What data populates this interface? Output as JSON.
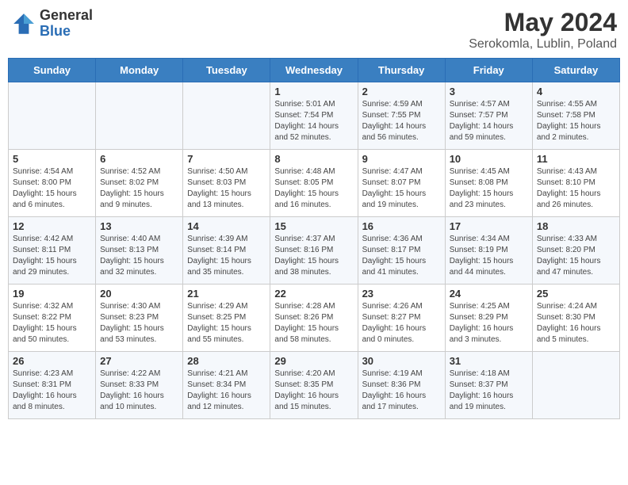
{
  "logo": {
    "general": "General",
    "blue": "Blue"
  },
  "title": "May 2024",
  "subtitle": "Serokomla, Lublin, Poland",
  "days_of_week": [
    "Sunday",
    "Monday",
    "Tuesday",
    "Wednesday",
    "Thursday",
    "Friday",
    "Saturday"
  ],
  "weeks": [
    [
      {
        "day": "",
        "info": ""
      },
      {
        "day": "",
        "info": ""
      },
      {
        "day": "",
        "info": ""
      },
      {
        "day": "1",
        "info": "Sunrise: 5:01 AM\nSunset: 7:54 PM\nDaylight: 14 hours\nand 52 minutes."
      },
      {
        "day": "2",
        "info": "Sunrise: 4:59 AM\nSunset: 7:55 PM\nDaylight: 14 hours\nand 56 minutes."
      },
      {
        "day": "3",
        "info": "Sunrise: 4:57 AM\nSunset: 7:57 PM\nDaylight: 14 hours\nand 59 minutes."
      },
      {
        "day": "4",
        "info": "Sunrise: 4:55 AM\nSunset: 7:58 PM\nDaylight: 15 hours\nand 2 minutes."
      }
    ],
    [
      {
        "day": "5",
        "info": "Sunrise: 4:54 AM\nSunset: 8:00 PM\nDaylight: 15 hours\nand 6 minutes."
      },
      {
        "day": "6",
        "info": "Sunrise: 4:52 AM\nSunset: 8:02 PM\nDaylight: 15 hours\nand 9 minutes."
      },
      {
        "day": "7",
        "info": "Sunrise: 4:50 AM\nSunset: 8:03 PM\nDaylight: 15 hours\nand 13 minutes."
      },
      {
        "day": "8",
        "info": "Sunrise: 4:48 AM\nSunset: 8:05 PM\nDaylight: 15 hours\nand 16 minutes."
      },
      {
        "day": "9",
        "info": "Sunrise: 4:47 AM\nSunset: 8:07 PM\nDaylight: 15 hours\nand 19 minutes."
      },
      {
        "day": "10",
        "info": "Sunrise: 4:45 AM\nSunset: 8:08 PM\nDaylight: 15 hours\nand 23 minutes."
      },
      {
        "day": "11",
        "info": "Sunrise: 4:43 AM\nSunset: 8:10 PM\nDaylight: 15 hours\nand 26 minutes."
      }
    ],
    [
      {
        "day": "12",
        "info": "Sunrise: 4:42 AM\nSunset: 8:11 PM\nDaylight: 15 hours\nand 29 minutes."
      },
      {
        "day": "13",
        "info": "Sunrise: 4:40 AM\nSunset: 8:13 PM\nDaylight: 15 hours\nand 32 minutes."
      },
      {
        "day": "14",
        "info": "Sunrise: 4:39 AM\nSunset: 8:14 PM\nDaylight: 15 hours\nand 35 minutes."
      },
      {
        "day": "15",
        "info": "Sunrise: 4:37 AM\nSunset: 8:16 PM\nDaylight: 15 hours\nand 38 minutes."
      },
      {
        "day": "16",
        "info": "Sunrise: 4:36 AM\nSunset: 8:17 PM\nDaylight: 15 hours\nand 41 minutes."
      },
      {
        "day": "17",
        "info": "Sunrise: 4:34 AM\nSunset: 8:19 PM\nDaylight: 15 hours\nand 44 minutes."
      },
      {
        "day": "18",
        "info": "Sunrise: 4:33 AM\nSunset: 8:20 PM\nDaylight: 15 hours\nand 47 minutes."
      }
    ],
    [
      {
        "day": "19",
        "info": "Sunrise: 4:32 AM\nSunset: 8:22 PM\nDaylight: 15 hours\nand 50 minutes."
      },
      {
        "day": "20",
        "info": "Sunrise: 4:30 AM\nSunset: 8:23 PM\nDaylight: 15 hours\nand 53 minutes."
      },
      {
        "day": "21",
        "info": "Sunrise: 4:29 AM\nSunset: 8:25 PM\nDaylight: 15 hours\nand 55 minutes."
      },
      {
        "day": "22",
        "info": "Sunrise: 4:28 AM\nSunset: 8:26 PM\nDaylight: 15 hours\nand 58 minutes."
      },
      {
        "day": "23",
        "info": "Sunrise: 4:26 AM\nSunset: 8:27 PM\nDaylight: 16 hours\nand 0 minutes."
      },
      {
        "day": "24",
        "info": "Sunrise: 4:25 AM\nSunset: 8:29 PM\nDaylight: 16 hours\nand 3 minutes."
      },
      {
        "day": "25",
        "info": "Sunrise: 4:24 AM\nSunset: 8:30 PM\nDaylight: 16 hours\nand 5 minutes."
      }
    ],
    [
      {
        "day": "26",
        "info": "Sunrise: 4:23 AM\nSunset: 8:31 PM\nDaylight: 16 hours\nand 8 minutes."
      },
      {
        "day": "27",
        "info": "Sunrise: 4:22 AM\nSunset: 8:33 PM\nDaylight: 16 hours\nand 10 minutes."
      },
      {
        "day": "28",
        "info": "Sunrise: 4:21 AM\nSunset: 8:34 PM\nDaylight: 16 hours\nand 12 minutes."
      },
      {
        "day": "29",
        "info": "Sunrise: 4:20 AM\nSunset: 8:35 PM\nDaylight: 16 hours\nand 15 minutes."
      },
      {
        "day": "30",
        "info": "Sunrise: 4:19 AM\nSunset: 8:36 PM\nDaylight: 16 hours\nand 17 minutes."
      },
      {
        "day": "31",
        "info": "Sunrise: 4:18 AM\nSunset: 8:37 PM\nDaylight: 16 hours\nand 19 minutes."
      },
      {
        "day": "",
        "info": ""
      }
    ]
  ]
}
